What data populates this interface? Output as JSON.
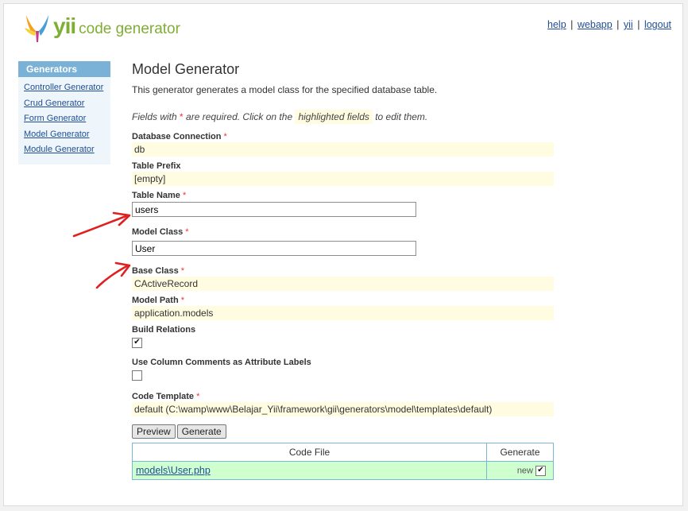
{
  "header": {
    "logo_yii": "yii",
    "logo_rest": "code generator",
    "links": [
      "help",
      "webapp",
      "yii",
      "logout"
    ],
    "separator": "|"
  },
  "sidebar": {
    "title": "Generators",
    "items": [
      "Controller Generator",
      "Crud Generator",
      "Form Generator",
      "Model Generator",
      "Module Generator"
    ]
  },
  "main": {
    "title": "Model Generator",
    "description": "This generator generates a model class for the specified database table.",
    "hint_start": "Fields with",
    "hint_star": "*",
    "hint_middle": "are required. Click on the",
    "hint_highlight": "highlighted fields",
    "hint_end": "to edit them."
  },
  "fields": {
    "db_connection": {
      "label": "Database Connection",
      "value": "db"
    },
    "table_prefix": {
      "label": "Table Prefix",
      "value": "[empty]"
    },
    "table_name": {
      "label": "Table Name",
      "value": "users"
    },
    "model_class": {
      "label": "Model Class",
      "value": "User"
    },
    "base_class": {
      "label": "Base Class",
      "value": "CActiveRecord"
    },
    "model_path": {
      "label": "Model Path",
      "value": "application.models"
    },
    "build_relations": {
      "label": "Build Relations",
      "checked": true
    },
    "column_comments": {
      "label": "Use Column Comments as Attribute Labels",
      "checked": false
    },
    "code_template": {
      "label": "Code Template",
      "value": "default (C:\\wamp\\www\\Belajar_Yii\\framework\\gii\\generators\\model\\templates\\default)"
    },
    "required_mark": "*"
  },
  "buttons": {
    "preview": "Preview",
    "generate": "Generate"
  },
  "code_table": {
    "headers": [
      "Code File",
      "Generate"
    ],
    "rows": [
      {
        "file": "models\\User.php",
        "status": "new",
        "checked": true
      }
    ]
  },
  "colors": {
    "accent": "#7fae35",
    "link": "#1f4e96",
    "sticky_bg": "#fffce1",
    "sidebar_head": "#7ab1d6",
    "row_new_bg": "#cfffcf",
    "arrow": "#e02020"
  },
  "check_glyph": "✔"
}
